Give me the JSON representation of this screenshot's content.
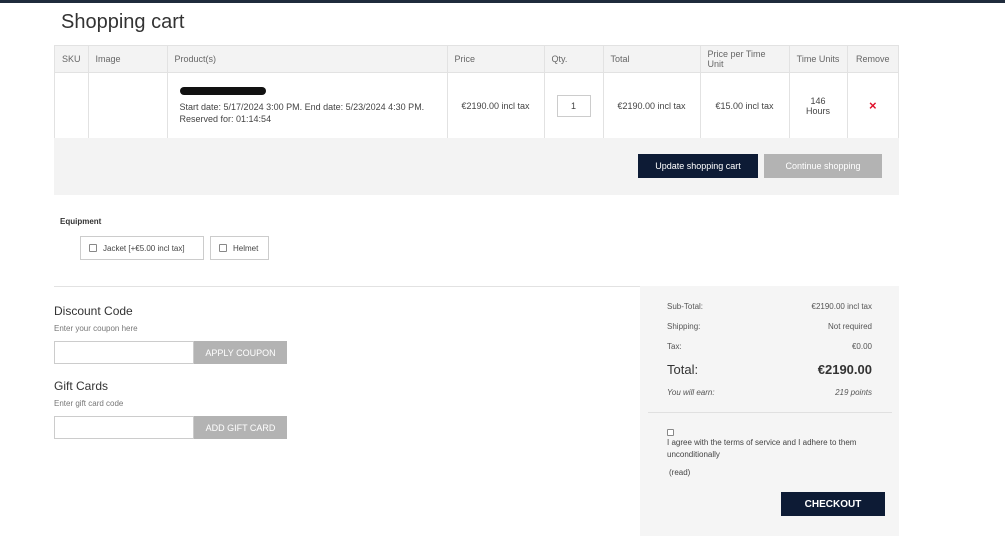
{
  "page": {
    "title": "Shopping cart"
  },
  "cart": {
    "columns": [
      "SKU",
      "Image",
      "Product(s)",
      "Price",
      "Qty.",
      "Total",
      "Price per Time Unit",
      "Time Units",
      "Remove"
    ],
    "items": [
      {
        "sku": "",
        "detail_line1": "Start date: 5/17/2024 3:00 PM. End date: 5/23/2024 4:30 PM.",
        "detail_line2": "Reserved for: 01:14:54",
        "price": "€2190.00 incl tax",
        "qty": "1",
        "total": "€2190.00 incl tax",
        "price_per_unit": "€15.00 incl tax",
        "time_units_value": "146",
        "time_units_label": "Hours",
        "remove_symbol": "×"
      }
    ],
    "update_label": "Update shopping cart",
    "continue_label": "Continue shopping"
  },
  "equipment": {
    "title": "Equipment",
    "options": [
      {
        "label": "Jacket [+€5.00 incl tax]",
        "checked": false
      },
      {
        "label": "Helmet",
        "checked": false
      }
    ]
  },
  "discount": {
    "title": "Discount Code",
    "hint": "Enter your coupon here",
    "input_value": "",
    "button_label": "APPLY COUPON"
  },
  "gift": {
    "title": "Gift Cards",
    "hint": "Enter gift card code",
    "input_value": "",
    "button_label": "ADD GIFT CARD"
  },
  "totals": {
    "subtotal_label": "Sub-Total:",
    "subtotal_value": "€2190.00 incl tax",
    "shipping_label": "Shipping:",
    "shipping_value": "Not required",
    "tax_label": "Tax:",
    "tax_value": "€0.00",
    "total_label": "Total:",
    "total_value": "€2190.00",
    "earn_label": "You will earn:",
    "earn_value": "219 points"
  },
  "terms": {
    "text": "I agree with the terms of service and I adhere to them unconditionally",
    "read_link": "(read)",
    "checked": false
  },
  "checkout": {
    "label": "CHECKOUT"
  },
  "colors": {
    "primary": "#0d1b35",
    "secondary": "#b3b3b3",
    "remove": "#e0112b"
  },
  "icons": {
    "remove": "close-icon",
    "checkbox": "checkbox-icon"
  }
}
